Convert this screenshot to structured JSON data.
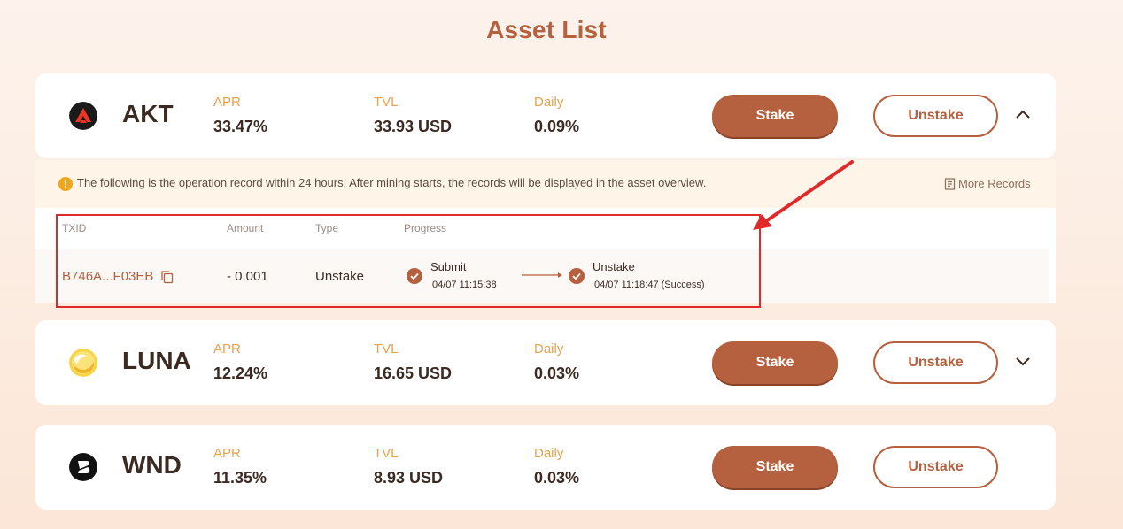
{
  "page": {
    "title": "Asset List"
  },
  "assets": [
    {
      "name": "AKT",
      "logo_icon": "akash-logo-icon",
      "apr_label": "APR",
      "apr": "33.47%",
      "tvl_label": "TVL",
      "tvl": "33.93 USD",
      "daily_label": "Daily",
      "daily": "0.09%",
      "stake_label": "Stake",
      "unstake_label": "Unstake",
      "expanded": true,
      "chevron_icon": "chevron-up-icon"
    },
    {
      "name": "LUNA",
      "logo_icon": "terra-luna-logo-icon",
      "apr_label": "APR",
      "apr": "12.24%",
      "tvl_label": "TVL",
      "tvl": "16.65 USD",
      "daily_label": "Daily",
      "daily": "0.03%",
      "stake_label": "Stake",
      "unstake_label": "Unstake",
      "expanded": false,
      "chevron_icon": "chevron-down-icon"
    },
    {
      "name": "WND",
      "logo_icon": "westend-logo-icon",
      "apr_label": "APR",
      "apr": "11.35%",
      "tvl_label": "TVL",
      "tvl": "8.93 USD",
      "daily_label": "Daily",
      "daily": "0.03%",
      "stake_label": "Stake",
      "unstake_label": "Unstake"
    }
  ],
  "records": {
    "notice": "The following is the operation record within 24 hours. After mining starts, the records will be displayed in the asset overview.",
    "more_records_label": "More Records",
    "columns": [
      "TXID",
      "Amount",
      "Type",
      "Progress"
    ],
    "rows": [
      {
        "txid": "B746A...F03EB",
        "amount": "- 0.001",
        "type": "Unstake",
        "steps": [
          {
            "title": "Submit",
            "time": "04/07 11:15:38"
          },
          {
            "title": "Unstake",
            "time": "04/07 11:18:47 (Success)"
          }
        ]
      }
    ]
  },
  "colors": {
    "accent": "#b5603e",
    "label_orange": "#e8a14b",
    "annotation_red": "#e02a2a"
  }
}
